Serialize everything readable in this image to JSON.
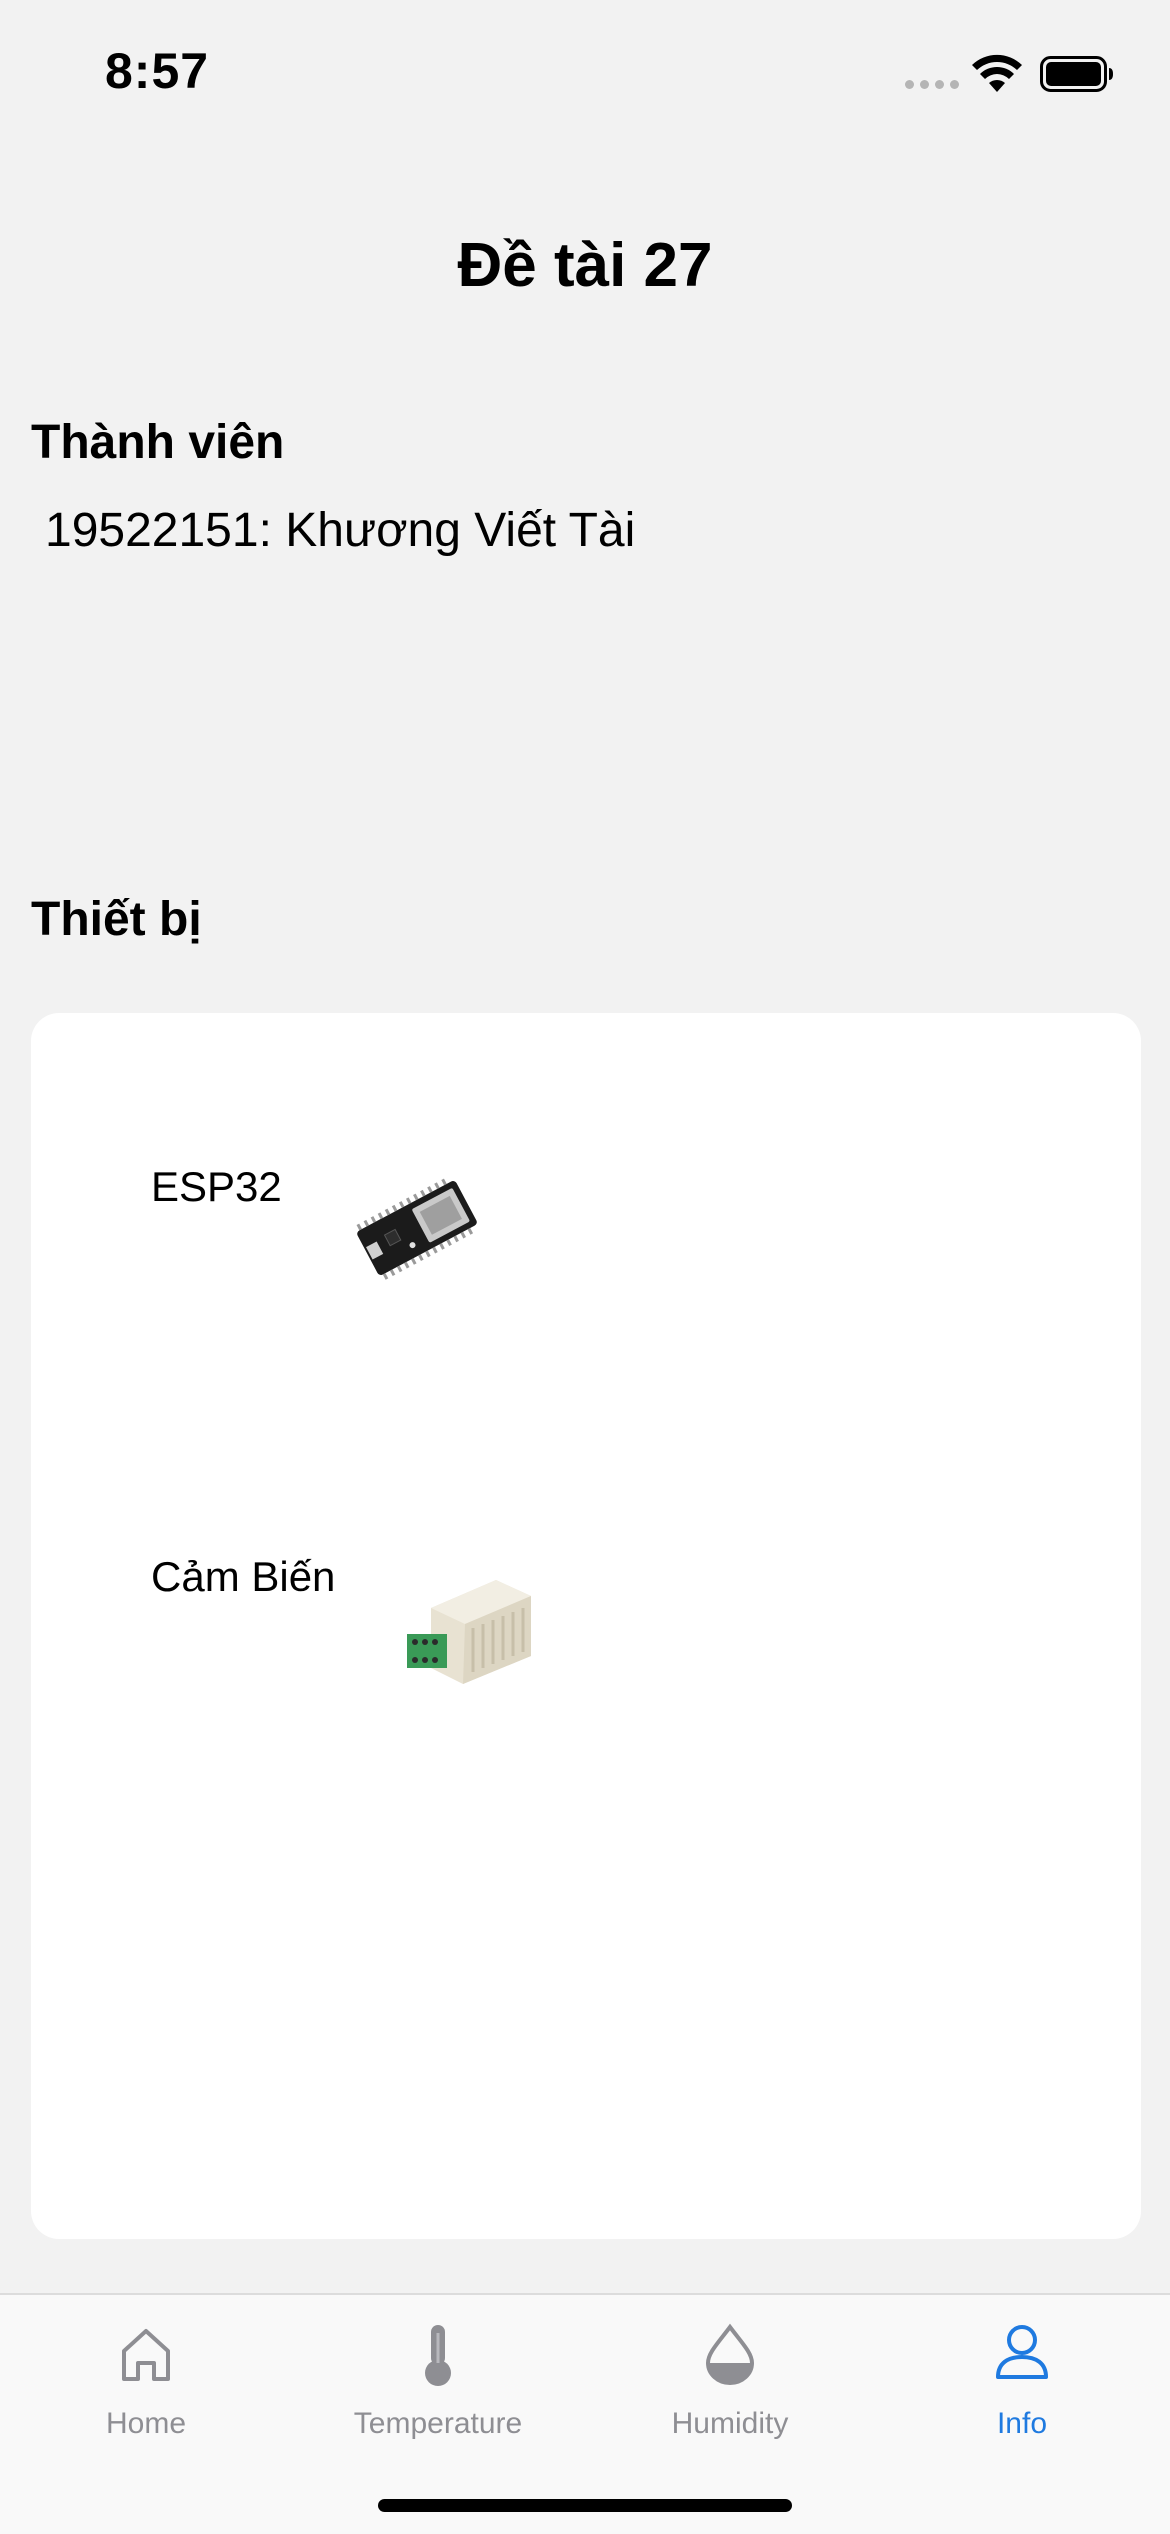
{
  "status_bar": {
    "time": "8:57",
    "icons": [
      "signal-dots-icon",
      "wifi-icon",
      "battery-icon"
    ]
  },
  "header": {
    "title": "Đề tài 27"
  },
  "members": {
    "heading": "Thành viên",
    "items": [
      "19522151: Khương Viết Tài"
    ]
  },
  "devices": {
    "heading": "Thiết bị",
    "items": [
      {
        "label": "ESP32",
        "image": "esp32-board-image"
      },
      {
        "label": "Cảm Biến",
        "image": "sensor-module-image"
      }
    ]
  },
  "tab_bar": {
    "tabs": [
      {
        "label": "Home",
        "icon": "home-icon",
        "active": false
      },
      {
        "label": "Temperature",
        "icon": "thermometer-icon",
        "active": false
      },
      {
        "label": "Humidity",
        "icon": "water-drop-icon",
        "active": false
      },
      {
        "label": "Info",
        "icon": "person-icon",
        "active": true
      }
    ]
  },
  "colors": {
    "accent": "#1f7ae0",
    "inactive": "#8e8e93",
    "background": "#f2f2f2",
    "card": "#ffffff"
  }
}
